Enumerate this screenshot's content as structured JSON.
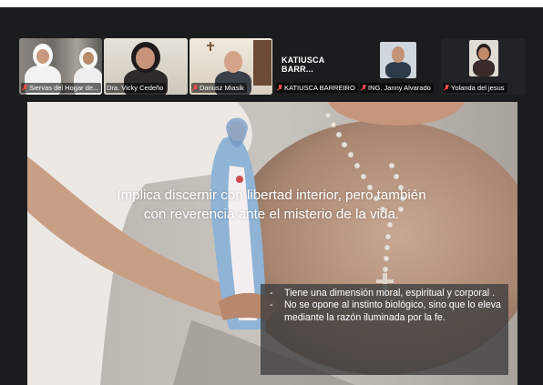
{
  "participants": [
    {
      "name": "Siervas del Hogar de...",
      "muted": true,
      "active": false
    },
    {
      "name": "Dra. Vicky Cedeño",
      "muted": false,
      "active": true
    },
    {
      "name": "Dariusz Miasik",
      "muted": true,
      "active": false
    },
    {
      "name": "KATIUSCA BARREIRO ...",
      "display_label": "KATIUSCA BARR...",
      "muted": true,
      "active": false,
      "video_off": true
    },
    {
      "name": "ING. Janny Alvarado",
      "muted": true,
      "active": false
    },
    {
      "name": "Yolanda del jesus",
      "muted": true,
      "active": false
    }
  ],
  "slide": {
    "caption": "Implica discernir con libertad interior, pero también con reverencia ante el misterio de la vida.",
    "bullets": [
      "Tiene una dimensión moral, espiritual y corporal .",
      "No se opone al instinto biológico, sino que lo eleva mediante la razón iluminada por la fe."
    ]
  },
  "colors": {
    "background": "#1b1c1e",
    "active_speaker": "#3fc66b",
    "mic_muted": "#ff4d4d"
  }
}
